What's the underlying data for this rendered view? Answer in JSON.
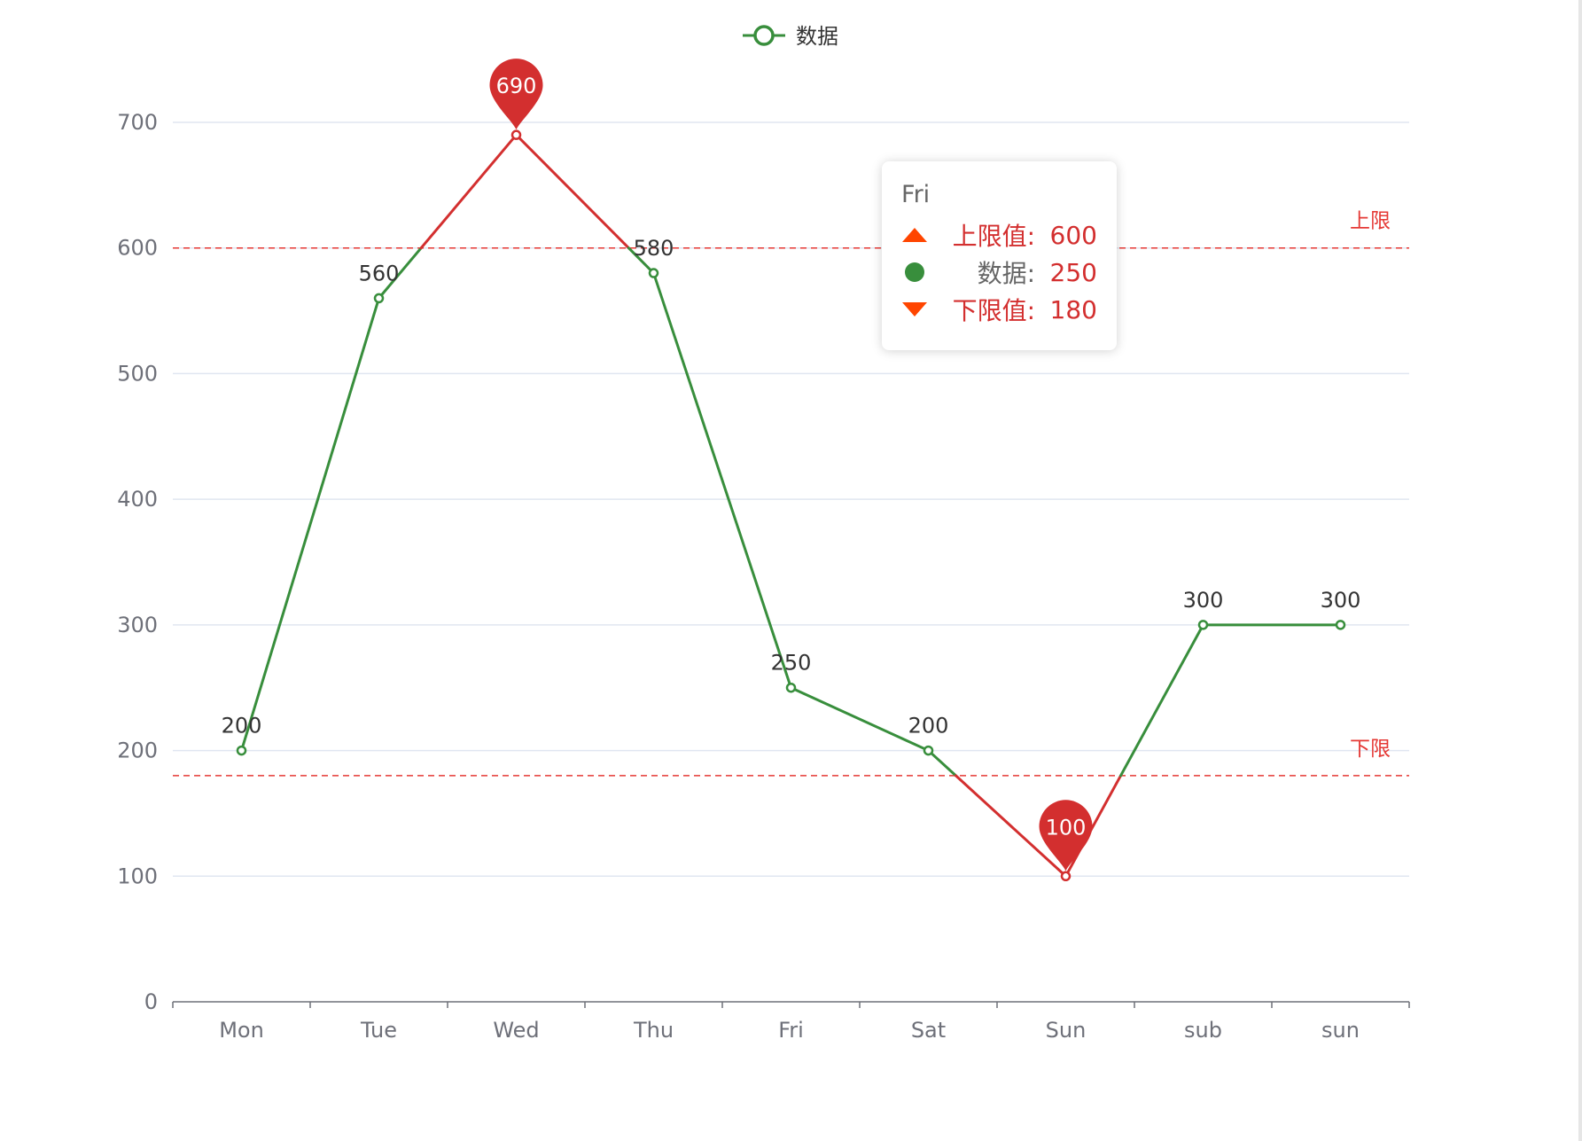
{
  "colors": {
    "series": "#388e3c",
    "above": "#d32f2f",
    "limit": "#e53935",
    "pin": "#d32f2f",
    "grid": "#e0e6f1",
    "axis": "#6e7079",
    "marker_up": "#ff4500"
  },
  "legend": {
    "label": "数据",
    "icon": "line-circle-icon"
  },
  "chart_data": {
    "type": "line",
    "categories": [
      "Mon",
      "Tue",
      "Wed",
      "Thu",
      "Fri",
      "Sat",
      "Sun",
      "sub",
      "sun"
    ],
    "series": [
      {
        "name": "数据",
        "values": [
          200,
          560,
          690,
          580,
          250,
          200,
          100,
          300,
          300
        ]
      }
    ],
    "ylim": [
      0,
      700
    ],
    "yticks": [
      0,
      100,
      200,
      300,
      400,
      500,
      600,
      700
    ],
    "grid": true,
    "legend_position": "top-center",
    "mark_lines": [
      {
        "label": "上限",
        "value": 600
      },
      {
        "label": "下限",
        "value": 180
      }
    ],
    "mark_points": [
      {
        "label": "690",
        "category": "Wed",
        "value": 690
      },
      {
        "label": "100",
        "category": "Sun",
        "value": 100
      }
    ],
    "data_labels": [
      "200",
      "560",
      "580",
      "250",
      "200",
      "300",
      "300"
    ]
  },
  "tooltip": {
    "title": "Fri",
    "rows": [
      {
        "icon": "triangle-up-icon",
        "name": "上限值:",
        "value": "600",
        "name_color": "#d32f2f"
      },
      {
        "icon": "circle-icon",
        "name": "数据:",
        "value": "250",
        "name_color": "#666666"
      },
      {
        "icon": "triangle-down-icon",
        "name": "下限值:",
        "value": "180",
        "name_color": "#d32f2f"
      }
    ]
  }
}
